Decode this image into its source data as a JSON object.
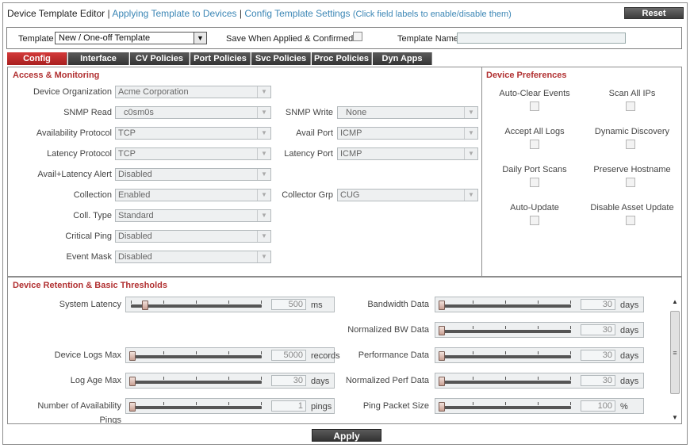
{
  "header": {
    "title": "Device Template Editor",
    "sep1": "|",
    "link_apply": "Applying Template to Devices",
    "sep2": "|",
    "link_config": "Config Template Settings",
    "hint": "(Click field labels to enable/disable them)",
    "reset_label": "Reset"
  },
  "template_row": {
    "template_label": "Template",
    "template_value": "New / One-off Template",
    "save_label": "Save When Applied & Confirmed",
    "name_label": "Template Name",
    "name_value": ""
  },
  "tabs": [
    {
      "label": "Config",
      "active": true
    },
    {
      "label": "Interface"
    },
    {
      "label": "CV Policies"
    },
    {
      "label": "Port Policies"
    },
    {
      "label": "Svc Policies"
    },
    {
      "label": "Proc Policies"
    },
    {
      "label": "Dyn Apps"
    }
  ],
  "access": {
    "title": "Access & Monitoring",
    "fields": {
      "device_org": {
        "label": "Device Organization",
        "value": "Acme Corporation"
      },
      "snmp_read": {
        "label": "SNMP Read",
        "value": "c0sm0s"
      },
      "snmp_write": {
        "label": "SNMP Write",
        "value": "None"
      },
      "avail_protocol": {
        "label": "Availability Protocol",
        "value": "TCP"
      },
      "avail_port": {
        "label": "Avail Port",
        "value": "ICMP"
      },
      "latency_protocol": {
        "label": "Latency Protocol",
        "value": "TCP"
      },
      "latency_port": {
        "label": "Latency Port",
        "value": "ICMP"
      },
      "avail_latency_alert": {
        "label": "Avail+Latency Alert",
        "value": "Disabled"
      },
      "collection": {
        "label": "Collection",
        "value": "Enabled"
      },
      "collector_grp": {
        "label": "Collector Grp",
        "value": "CUG"
      },
      "coll_type": {
        "label": "Coll. Type",
        "value": "Standard"
      },
      "critical_ping": {
        "label": "Critical Ping",
        "value": "Disabled"
      },
      "event_mask": {
        "label": "Event Mask",
        "value": "Disabled"
      }
    }
  },
  "prefs": {
    "title": "Device Preferences",
    "items": [
      {
        "label": "Auto-Clear Events"
      },
      {
        "label": "Scan All IPs"
      },
      {
        "label": "Accept All Logs"
      },
      {
        "label": "Dynamic Discovery"
      },
      {
        "label": "Daily Port Scans"
      },
      {
        "label": "Preserve Hostname"
      },
      {
        "label": "Auto-Update"
      },
      {
        "label": "Disable Asset Update"
      }
    ]
  },
  "retention": {
    "title": "Device Retention & Basic Thresholds",
    "left": [
      {
        "label": "System Latency",
        "value": "500",
        "unit": "ms",
        "level": 0.1
      },
      {
        "label": "Device Logs Max",
        "value": "5000",
        "unit": "records",
        "level": 0.0
      },
      {
        "label": "Log Age Max",
        "value": "30",
        "unit": "days",
        "level": 0.0
      },
      {
        "label": "Number of Availability",
        "label2": "Pings",
        "value": "1",
        "unit": "pings",
        "level": 0.0
      }
    ],
    "right": [
      {
        "label": "Bandwidth Data",
        "value": "30",
        "unit": "days",
        "level": 0.0
      },
      {
        "label": "Normalized BW Data",
        "value": "30",
        "unit": "days",
        "level": 0.0
      },
      {
        "label": "Performance Data",
        "value": "30",
        "unit": "days",
        "level": 0.0
      },
      {
        "label": "Normalized Perf Data",
        "value": "30",
        "unit": "days",
        "level": 0.0
      },
      {
        "label": "Ping Packet Size",
        "value": "100",
        "unit": "%",
        "level": 0.0
      }
    ]
  },
  "apply_label": "Apply",
  "icons": {
    "dropdown": "chevron-down-icon",
    "scroll_up": "arrow-up-icon",
    "scroll_down": "arrow-down-icon"
  }
}
